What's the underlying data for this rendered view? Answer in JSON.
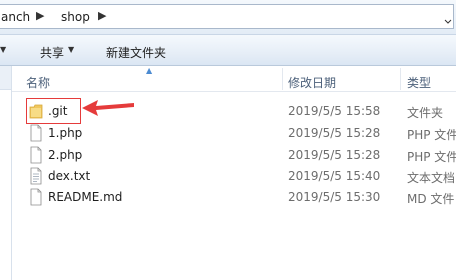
{
  "address": {
    "crumbs": [
      "anch",
      "shop"
    ],
    "separator_icon": "chevron-right-icon"
  },
  "toolbar": {
    "share_label": "共享",
    "new_folder_label": "新建文件夹"
  },
  "columns": {
    "name": "名称",
    "date": "修改日期",
    "type": "类型"
  },
  "files": [
    {
      "name": ".git",
      "date": "2019/5/5 15:58",
      "type": "文件夹",
      "icon": "folder-icon"
    },
    {
      "name": "1.php",
      "date": "2019/5/5 15:28",
      "type": "PHP 文件",
      "icon": "file-icon"
    },
    {
      "name": "2.php",
      "date": "2019/5/5 15:28",
      "type": "PHP 文件",
      "icon": "file-icon"
    },
    {
      "name": "dex.txt",
      "date": "2019/5/5 15:40",
      "type": "文本文档",
      "icon": "text-file-icon"
    },
    {
      "name": "README.md",
      "date": "2019/5/5 15:30",
      "type": "MD 文件",
      "icon": "file-icon"
    }
  ],
  "annotation": {
    "highlight_color": "#e53b3b"
  },
  "colors": {
    "folder": "#f0c75e",
    "header_text": "#4c607a",
    "secondary_text": "#6d6d6d"
  }
}
